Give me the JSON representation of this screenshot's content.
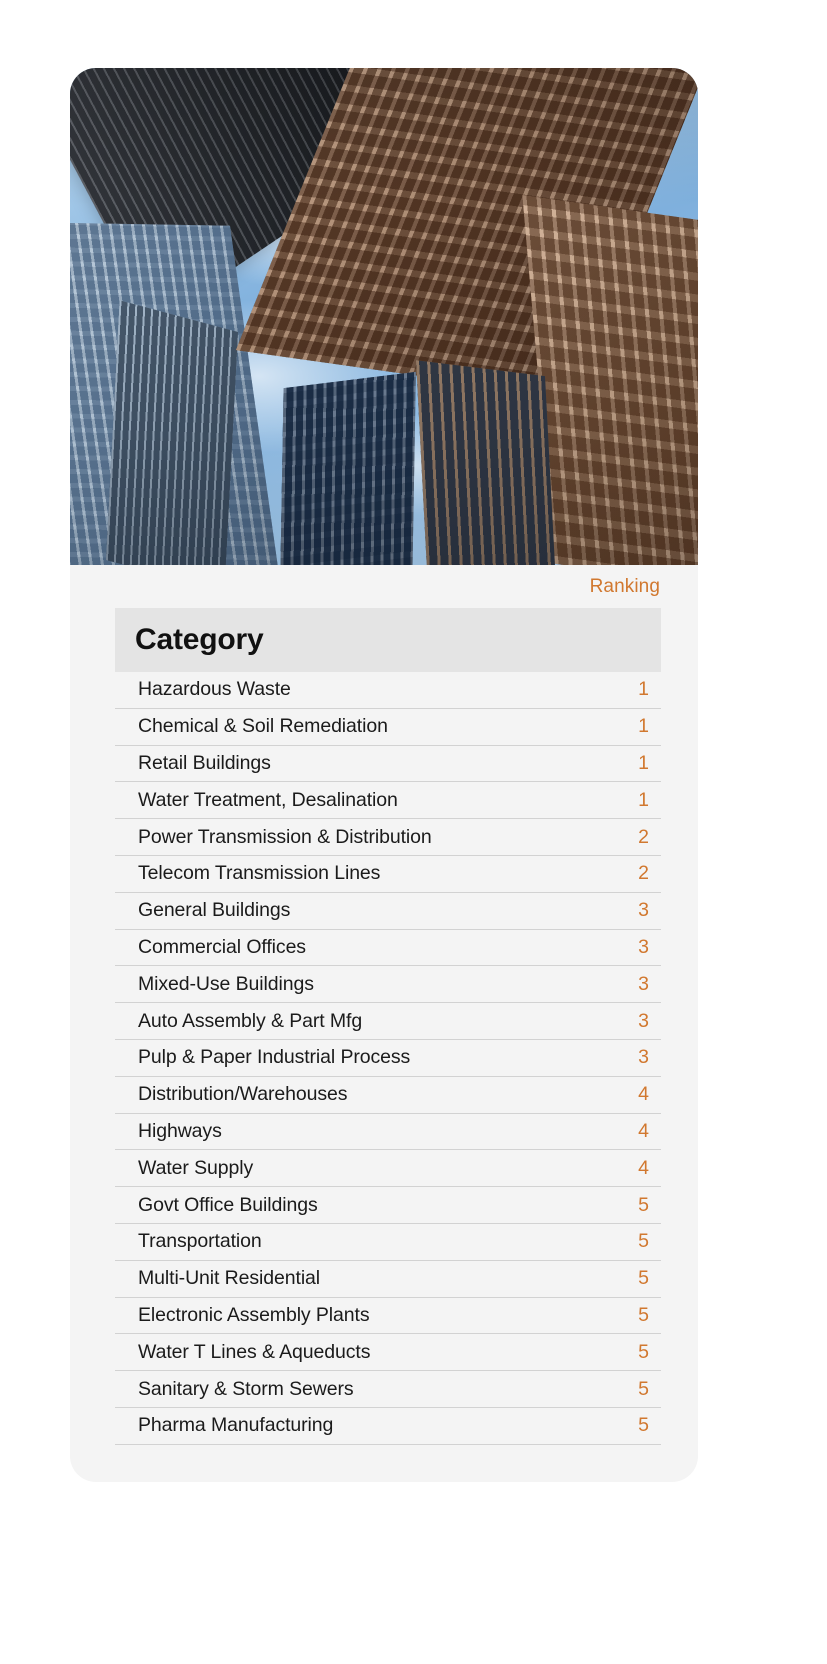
{
  "card": {
    "hero_image_alt": "city-skyline-looking-up-photo",
    "accent_color": "#d1782f",
    "background_color": "#f4f4f4",
    "header_row_color": "#e4e4e4"
  },
  "table": {
    "rank_caption": "Ranking",
    "columns": [
      "Category",
      "Ranking"
    ],
    "rows": [
      {
        "category": "Hazardous Waste",
        "ranking": "1"
      },
      {
        "category": "Chemical & Soil Remediation",
        "ranking": "1"
      },
      {
        "category": "Retail Buildings",
        "ranking": "1"
      },
      {
        "category": "Water Treatment, Desalination",
        "ranking": "1"
      },
      {
        "category": "Power Transmission & Distribution",
        "ranking": "2"
      },
      {
        "category": "Telecom Transmission Lines",
        "ranking": "2"
      },
      {
        "category": "General Buildings",
        "ranking": "3"
      },
      {
        "category": "Commercial Offices",
        "ranking": "3"
      },
      {
        "category": "Mixed-Use Buildings",
        "ranking": "3"
      },
      {
        "category": "Auto Assembly & Part Mfg",
        "ranking": "3"
      },
      {
        "category": "Pulp & Paper Industrial Process",
        "ranking": "3"
      },
      {
        "category": "Distribution/Warehouses",
        "ranking": "4"
      },
      {
        "category": "Highways",
        "ranking": "4"
      },
      {
        "category": "Water Supply",
        "ranking": "4"
      },
      {
        "category": "Govt Office Buildings",
        "ranking": "5"
      },
      {
        "category": "Transportation",
        "ranking": "5"
      },
      {
        "category": "Multi-Unit Residential",
        "ranking": "5"
      },
      {
        "category": "Electronic Assembly Plants",
        "ranking": "5"
      },
      {
        "category": "Water T Lines & Aqueducts",
        "ranking": "5"
      },
      {
        "category": "Sanitary & Storm Sewers",
        "ranking": "5"
      },
      {
        "category": "Pharma Manufacturing",
        "ranking": "5"
      }
    ]
  }
}
